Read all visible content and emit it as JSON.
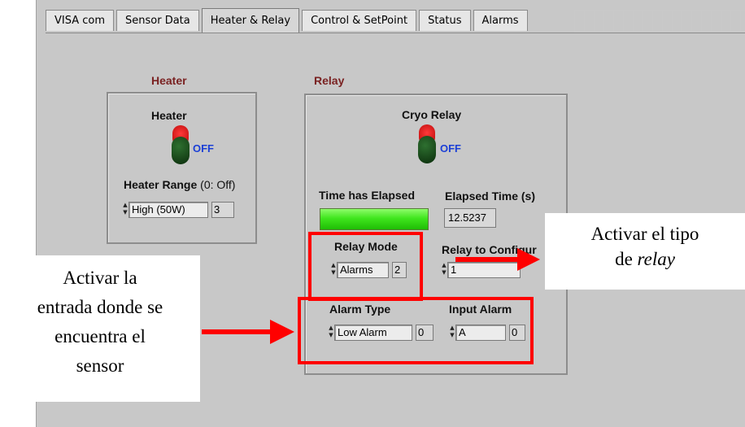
{
  "tabs": [
    {
      "label": "VISA com",
      "active": false
    },
    {
      "label": "Sensor Data",
      "active": false
    },
    {
      "label": "Heater & Relay",
      "active": true
    },
    {
      "label": "Control & SetPoint",
      "active": false
    },
    {
      "label": "Status",
      "active": false
    },
    {
      "label": "Alarms",
      "active": false
    }
  ],
  "heater": {
    "group_title": "Heater",
    "switch_label": "Heater",
    "switch_state": "OFF",
    "range_label_bold": "Heater Range",
    "range_label_suffix": " (0: Off)",
    "range_value": "High (50W)",
    "range_number": "3"
  },
  "relay": {
    "group_title": "Relay",
    "switch_label": "Cryo Relay",
    "switch_state": "OFF",
    "time_elapsed_label": "Time has Elapsed",
    "elapsed_time_label": "Elapsed Time (s)",
    "elapsed_time_value": "12.5237",
    "relay_mode_label": "Relay Mode",
    "relay_mode_value": "Alarms",
    "relay_mode_number": "2",
    "relay_config_label": "Relay to Configur",
    "relay_config_value": "1",
    "alarm_type_label": "Alarm Type",
    "alarm_type_value": "Low Alarm",
    "alarm_type_number": "0",
    "input_alarm_label": "Input Alarm",
    "input_alarm_value": "A",
    "input_alarm_number": "0"
  },
  "callouts": {
    "right_line1": "Activar el tipo",
    "right_line2_prefix": "de ",
    "right_line2_italic": "relay",
    "left_line1": "Activar la",
    "left_line2": "entrada donde se",
    "left_line3": "encuentra el",
    "left_line4": "sensor"
  },
  "colors": {
    "group_title": "#7a2222",
    "off_text": "#1b3fd6",
    "annotation_red": "#ff0000",
    "led_green": "#40e61e"
  }
}
